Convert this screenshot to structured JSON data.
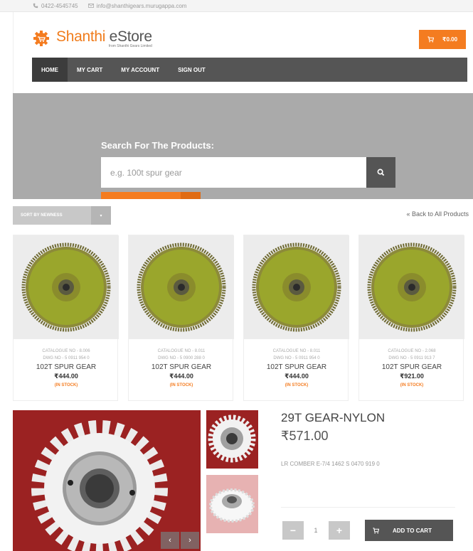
{
  "topbar": {
    "phone": "0422-4545745",
    "email": "info@shanthigears.murugappa.com"
  },
  "header": {
    "logo_name_part1": "Shanthi",
    "logo_name_part2": "eStore",
    "logo_tagline": "from Shanthi Gears Limited",
    "cart_total": "₹0.00"
  },
  "nav": {
    "items": [
      {
        "label": "HOME"
      },
      {
        "label": "MY CART"
      },
      {
        "label": "MY ACCOUNT"
      },
      {
        "label": "SIGN OUT"
      }
    ]
  },
  "search": {
    "title": "Search For The Products:",
    "placeholder": "e.g. 100t spur gear"
  },
  "toolbar": {
    "sort_label": "SORT BY NEWNESS",
    "back_link": "« Back to All Products"
  },
  "products": [
    {
      "catalogue": "CATALOGUE NO - 8.006",
      "dwg": "DWG NO - 5 0911 954 0",
      "name": "102T SPUR GEAR",
      "price": "₹444.00",
      "stock": "(IN STOCK)"
    },
    {
      "catalogue": "CATALOGUE NO - 8.011",
      "dwg": "DWG NO - 5 0900 288 0",
      "name": "102T SPUR GEAR",
      "price": "₹444.00",
      "stock": "(IN STOCK)"
    },
    {
      "catalogue": "CATALOGUE NO - 8.011",
      "dwg": "DWG NO - 5 0911 954 0",
      "name": "102T SPUR GEAR",
      "price": "₹444.00",
      "stock": "(IN STOCK)"
    },
    {
      "catalogue": "CATALOGUE NO - 2.068",
      "dwg": "DWG NO - 5 0911 913 7",
      "name": "102T SPUR GEAR",
      "price": "₹921.00",
      "stock": "(IN STOCK)"
    }
  ],
  "detail": {
    "title": "29T GEAR-NYLON",
    "price": "₹571.00",
    "description": "LR COMBER E-7/4 1462 S 0470 919 0",
    "quantity": "1",
    "minus_label": "−",
    "plus_label": "+",
    "add_to_cart_label": "ADD TO CART",
    "gallery_prev": "‹",
    "gallery_next": "›"
  },
  "colors": {
    "accent": "#f47c20",
    "nav_bg": "#555555",
    "hero_bg": "#aaaaaa",
    "gear_green": "#9aa62c",
    "product_bg": "#9b2222"
  },
  "icons": {
    "phone": "phone-icon",
    "email": "envelope-icon",
    "cart": "cart-icon",
    "search": "search-icon"
  }
}
